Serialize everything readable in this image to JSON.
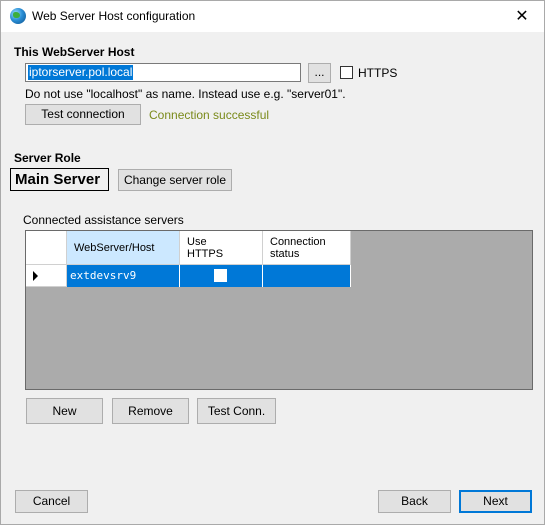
{
  "window": {
    "title": "Web Server Host configuration",
    "close_label": "✕"
  },
  "host_section": {
    "title": "This WebServer Host",
    "host_value": "iptorserver.pol.local",
    "browse_label": "...",
    "https_label": "HTTPS",
    "https_checked": false,
    "hint": "Do not use \"localhost\" as name. Instead use e.g. \"server01\".",
    "test_button": "Test connection",
    "test_status": "Connection successful"
  },
  "role_section": {
    "title": "Server Role",
    "role_value": "Main Server",
    "change_button": "Change server role"
  },
  "assist_section": {
    "label": "Connected assistance servers",
    "columns": {
      "host": "WebServer/Host",
      "https_line1": "Use",
      "https_line2": "HTTPS",
      "status_line1": "Connection",
      "status_line2": "status"
    },
    "rows": [
      {
        "host": "extdevsrv9",
        "use_https": false,
        "status": ""
      }
    ],
    "new_button": "New",
    "remove_button": "Remove",
    "test_button": "Test Conn."
  },
  "footer": {
    "cancel_label": "Cancel",
    "back_label": "Back",
    "next_label": "Next"
  },
  "colors": {
    "selection": "#0078d7",
    "success_text": "#7a8a1a",
    "grid_background": "#ababab"
  }
}
